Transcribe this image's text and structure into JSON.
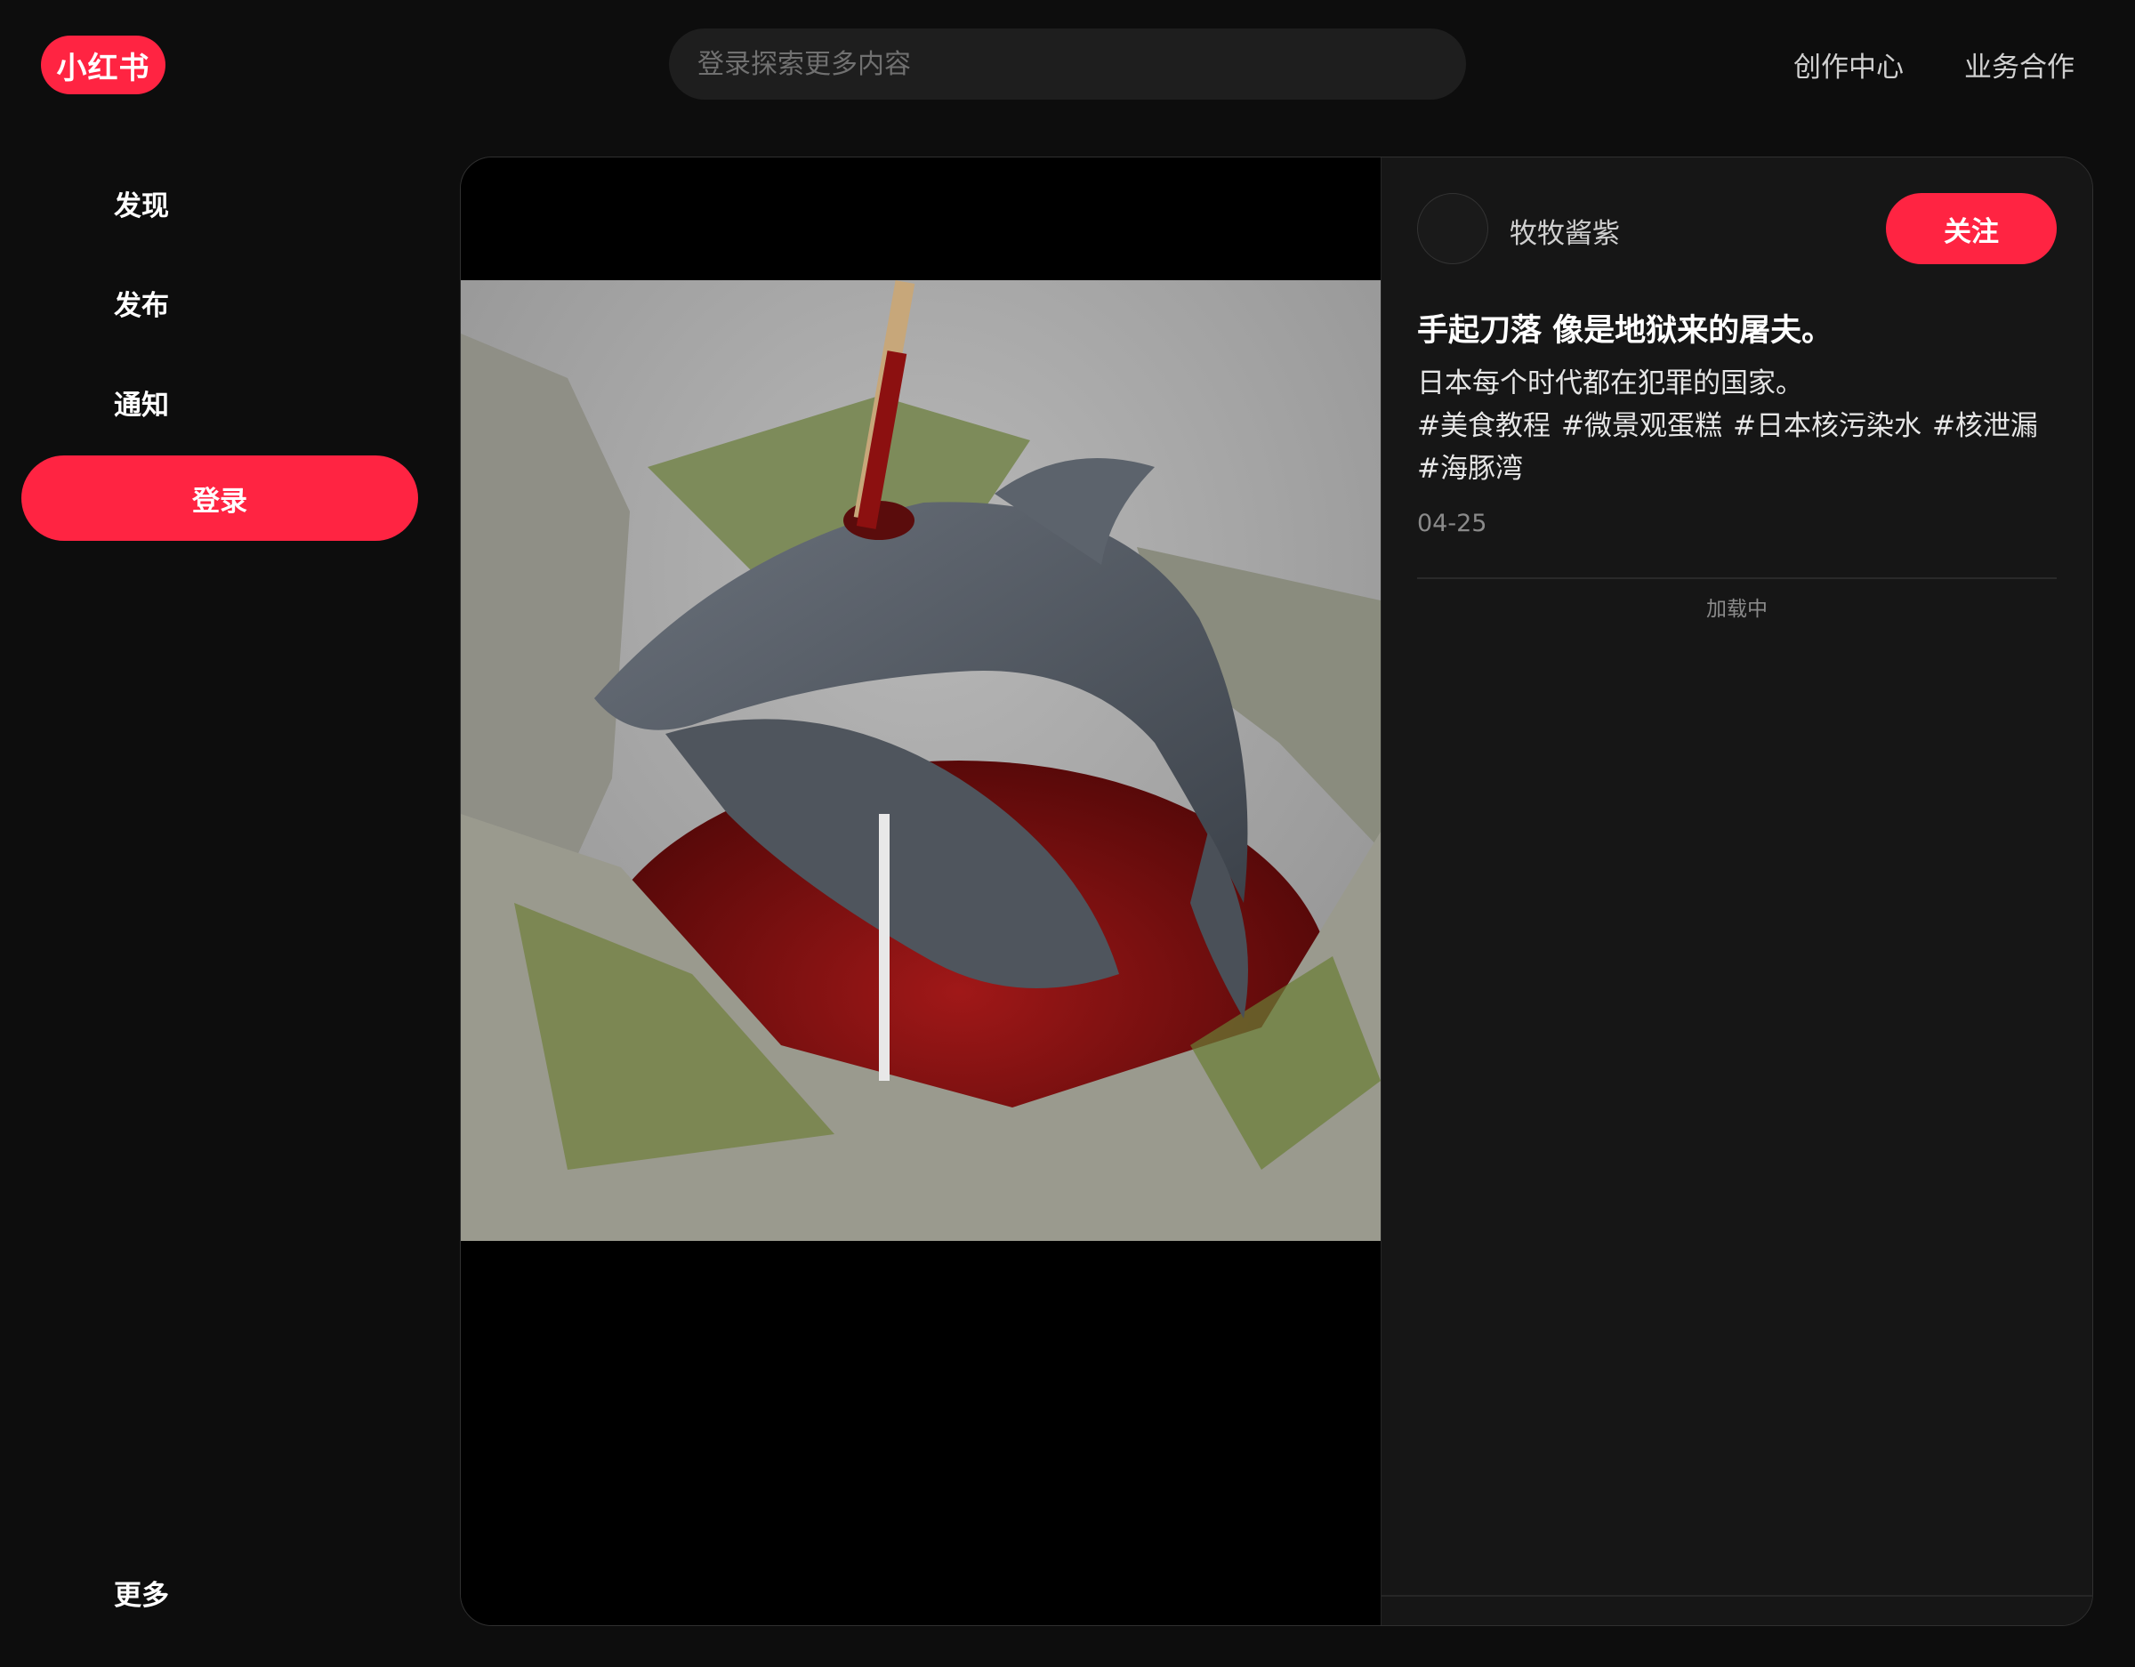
{
  "header": {
    "logo_text": "小红书",
    "search_placeholder": "登录探索更多内容",
    "links": [
      "创作中心",
      "业务合作"
    ]
  },
  "sidebar": {
    "items": [
      "发现",
      "发布",
      "通知"
    ],
    "login_label": "登录",
    "more_label": "更多"
  },
  "note": {
    "author": "牧牧酱紫",
    "follow_label": "关注",
    "title": "手起刀落 像是地狱来的屠夫。",
    "description": "日本每个时代都在犯罪的国家。",
    "tags": [
      "#美食教程",
      "#微景观蛋糕",
      "#日本核污染水",
      "#核泄漏",
      "#海豚湾"
    ],
    "date": "04-25",
    "comments_status": "加载中"
  },
  "colors": {
    "brand": "#ff2442",
    "background": "#0d0d0d",
    "panel": "#161616"
  }
}
